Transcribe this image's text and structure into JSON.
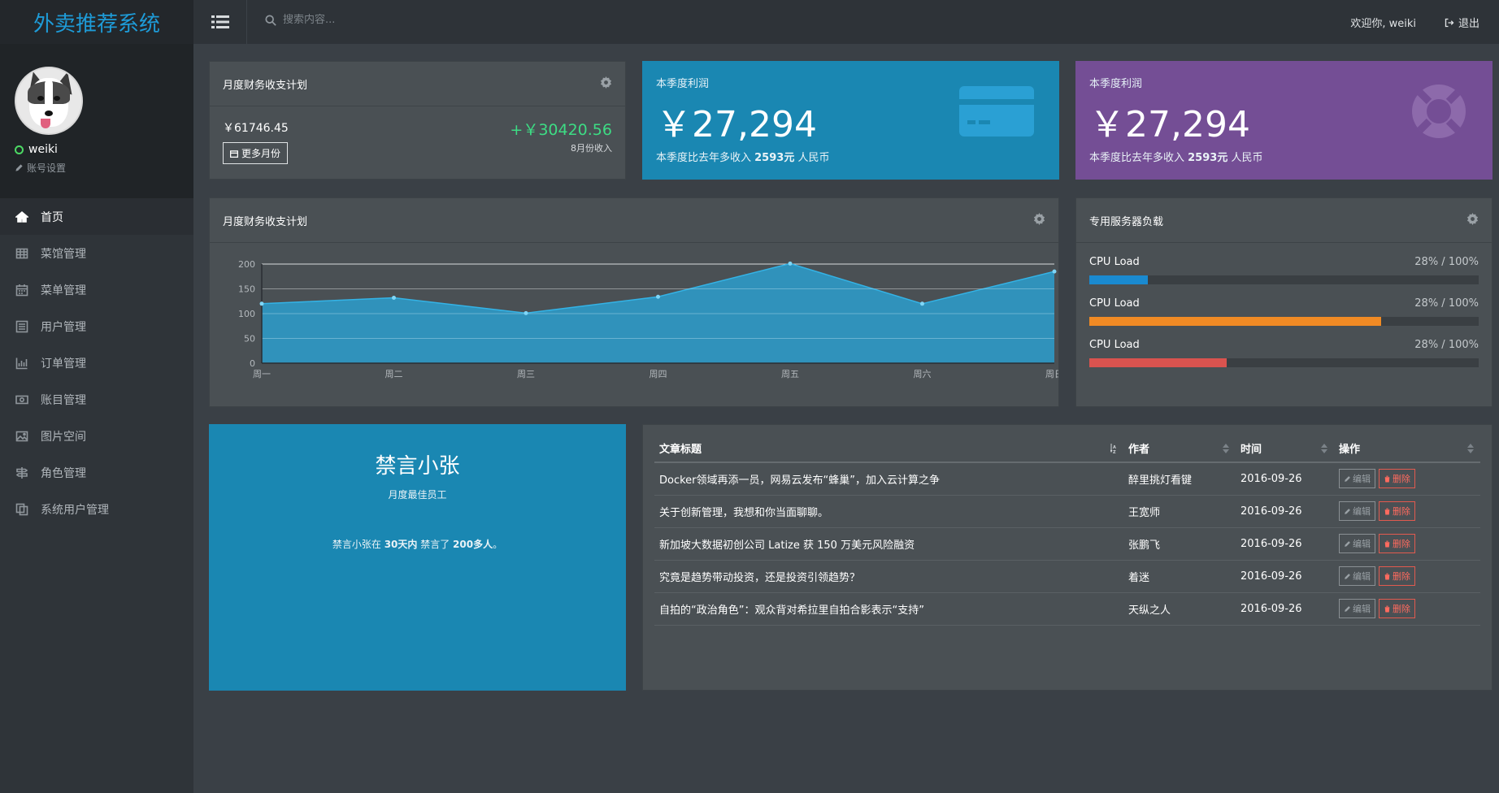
{
  "app": {
    "title": "外卖推荐系统"
  },
  "header": {
    "search_placeholder": "搜索内容...",
    "welcome": "欢迎你, weiki",
    "logout": "退出"
  },
  "user": {
    "name": "weiki",
    "settings": "账号设置"
  },
  "nav": [
    {
      "label": "首页",
      "icon": "home-icon"
    },
    {
      "label": "菜馆管理",
      "icon": "table-icon"
    },
    {
      "label": "菜单管理",
      "icon": "calendar-icon"
    },
    {
      "label": "用户管理",
      "icon": "list-alt-icon"
    },
    {
      "label": "订单管理",
      "icon": "bar-chart-icon"
    },
    {
      "label": "账目管理",
      "icon": "money-icon"
    },
    {
      "label": "图片空间",
      "icon": "picture-icon"
    },
    {
      "label": "角色管理",
      "icon": "sign-icon"
    },
    {
      "label": "系统用户管理",
      "icon": "copy-icon"
    }
  ],
  "finance": {
    "title": "月度财务收支计划",
    "expense": "￥61746.45",
    "more_button": "更多月份",
    "income": "+￥30420.56",
    "income_label": "8月份收入"
  },
  "stats": [
    {
      "label": "本季度利润",
      "value": "￥27,294",
      "desc_pre": "本季度比去年多收入 ",
      "desc_bold": "2593元",
      "desc_post": " 人民币",
      "color": "#1a87b2",
      "icon": "credit-card-icon"
    },
    {
      "label": "本季度利润",
      "value": "￥27,294",
      "desc_pre": "本季度比去年多收入 ",
      "desc_bold": "2593元",
      "desc_post": " 人民币",
      "color": "#744e95",
      "icon": "life-ring-icon"
    }
  ],
  "chart_panel": {
    "title": "月度财务收支计划"
  },
  "chart_data": {
    "type": "area",
    "categories": [
      "周一",
      "周二",
      "周三",
      "周四",
      "周五",
      "周六",
      "周日"
    ],
    "series": [
      {
        "values": [
          120,
          132,
          101,
          134,
          201,
          120,
          185
        ]
      }
    ],
    "ylim": [
      0,
      200
    ],
    "yticks": [
      0,
      50,
      100,
      150,
      200
    ],
    "grid": true,
    "color": "#29a5d8"
  },
  "server": {
    "title": "专用服务器负载",
    "rows": [
      {
        "label": "CPU Load",
        "pct_text": "28% / 100%",
        "level": 0.15,
        "color": "#1a8ad0"
      },
      {
        "label": "CPU Load",
        "pct_text": "28% / 100%",
        "level": 0.75,
        "color": "#f08a24"
      },
      {
        "label": "CPU Load",
        "pct_text": "28% / 100%",
        "level": 0.352,
        "color": "#d9534f"
      }
    ]
  },
  "profile_card": {
    "name": "禁言小张",
    "subtitle": "月度最佳员工",
    "desc_pre": "禁言小张在 ",
    "desc_b1": "30天内",
    "desc_mid": " 禁言了 ",
    "desc_b2": "200多人",
    "desc_post": "。",
    "color": "#1a87b2"
  },
  "articles": {
    "headers": [
      "文章标题",
      "作者",
      "时间",
      "操作"
    ],
    "edit_label": "编辑",
    "delete_label": "删除",
    "rows": [
      {
        "title": "Docker领域再添一员，网易云发布“蜂巢”，加入云计算之争",
        "author": "醉里挑灯看键",
        "date": "2016-09-26"
      },
      {
        "title": "关于创新管理，我想和你当面聊聊。",
        "author": "王宽师",
        "date": "2016-09-26"
      },
      {
        "title": "新加坡大数据初创公司 Latize 获 150 万美元风险融资",
        "author": "张鹏飞",
        "date": "2016-09-26"
      },
      {
        "title": "究竟是趋势带动投资，还是投资引领趋势？",
        "author": "着迷",
        "date": "2016-09-26"
      },
      {
        "title": "自拍的“政治角色”：观众背对希拉里自拍合影表示“支持”",
        "author": "天纵之人",
        "date": "2016-09-26"
      }
    ]
  }
}
